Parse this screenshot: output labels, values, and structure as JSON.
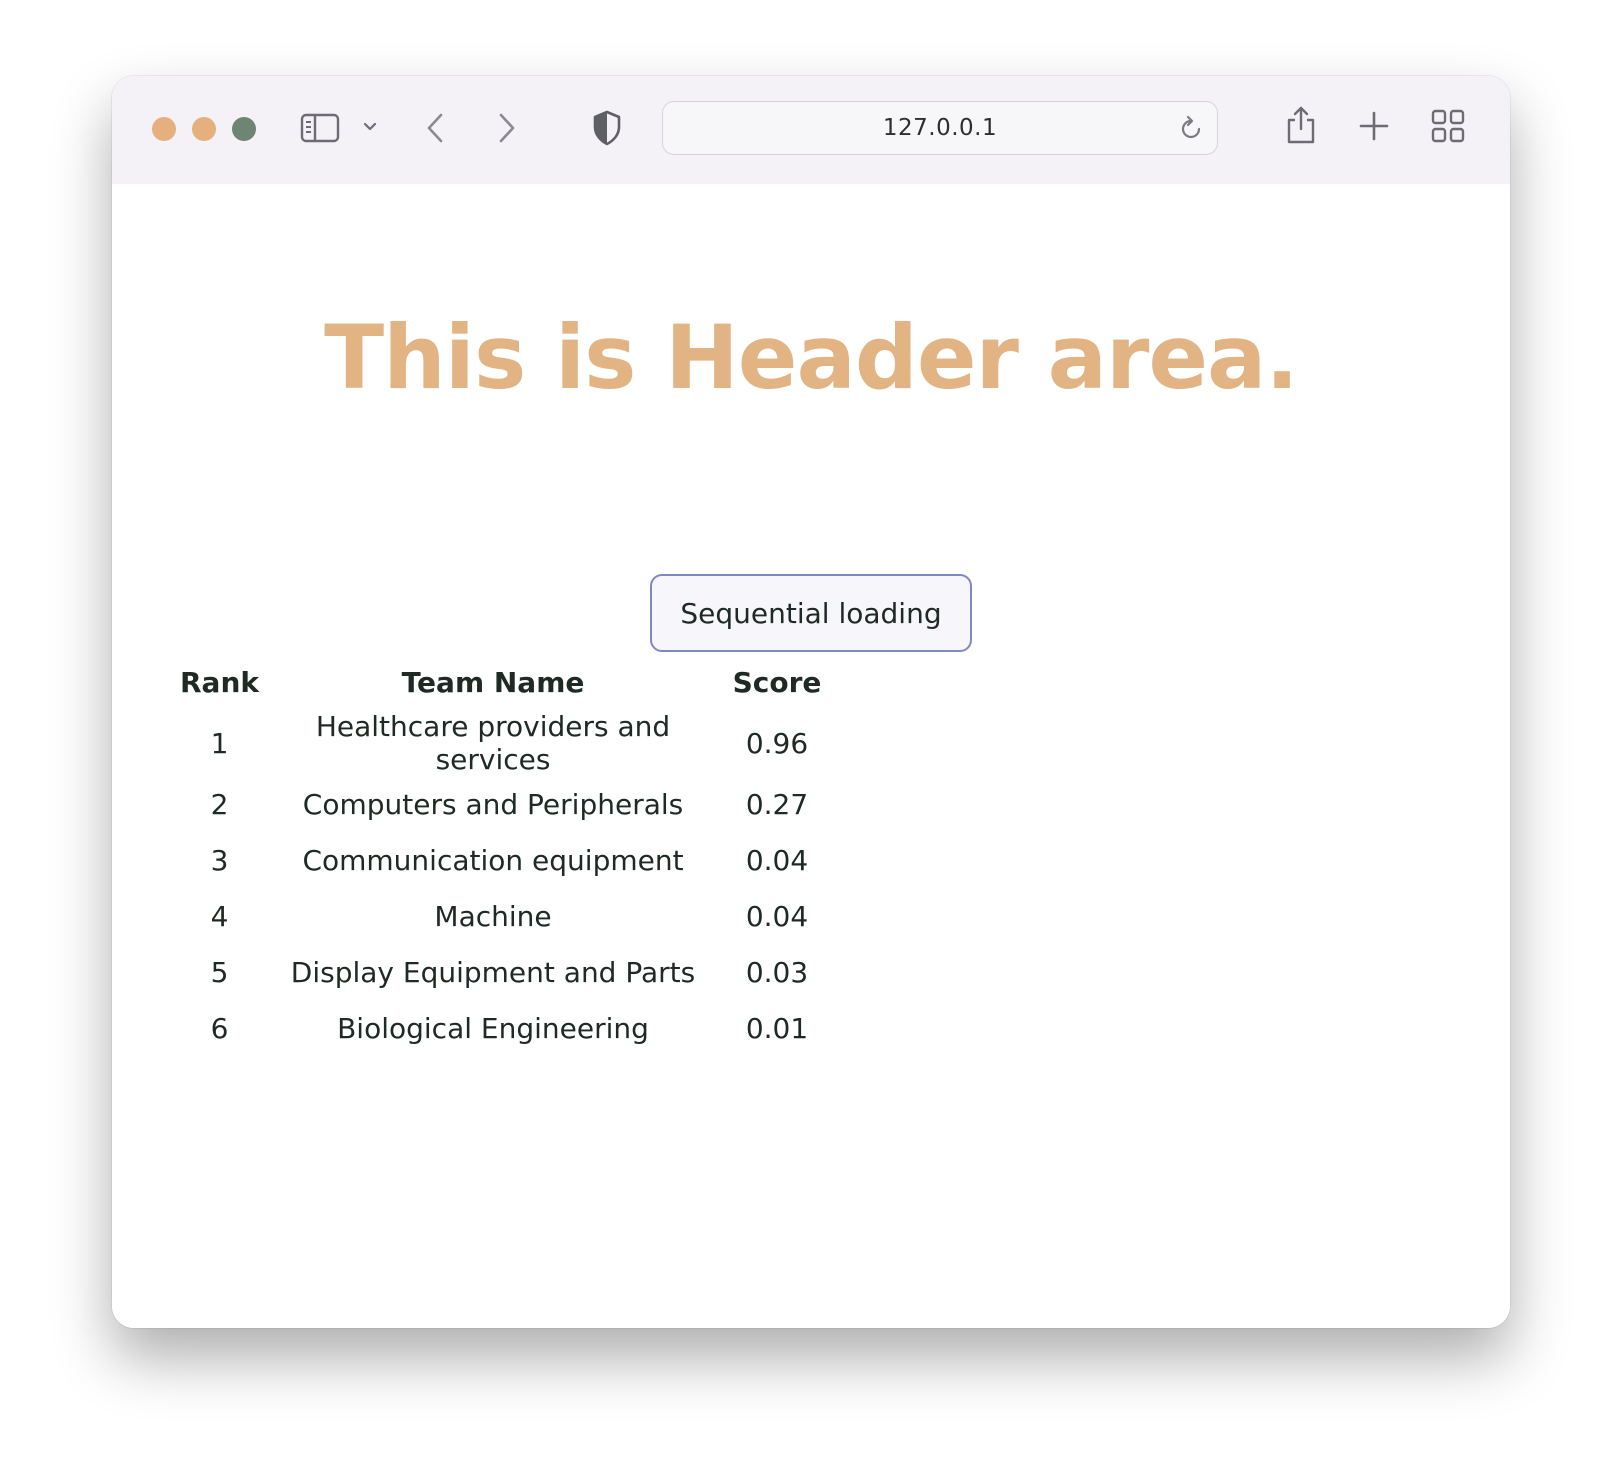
{
  "browser": {
    "url": "127.0.0.1",
    "traffic_light_colors": [
      "#e5b07e",
      "#e5b07e",
      "#6f8574"
    ],
    "icons": [
      "sidebar-icon",
      "chevron-down-icon",
      "back-icon",
      "forward-icon",
      "shield-icon",
      "reload-icon",
      "share-icon",
      "plus-icon",
      "tab-overview-icon"
    ]
  },
  "page": {
    "header": "This is Header area.",
    "button_label": "Sequential loading",
    "accent_color": "#e2b484",
    "table": {
      "columns": [
        "Rank",
        "Team Name",
        "Score"
      ],
      "rows": [
        {
          "rank": "1",
          "team": "Healthcare providers and services",
          "score": "0.96"
        },
        {
          "rank": "2",
          "team": "Computers and Peripherals",
          "score": "0.27"
        },
        {
          "rank": "3",
          "team": "Communication equipment",
          "score": "0.04"
        },
        {
          "rank": "4",
          "team": "Machine",
          "score": "0.04"
        },
        {
          "rank": "5",
          "team": "Display Equipment and Parts",
          "score": "0.03"
        },
        {
          "rank": "6",
          "team": "Biological Engineering",
          "score": "0.01"
        }
      ]
    }
  }
}
